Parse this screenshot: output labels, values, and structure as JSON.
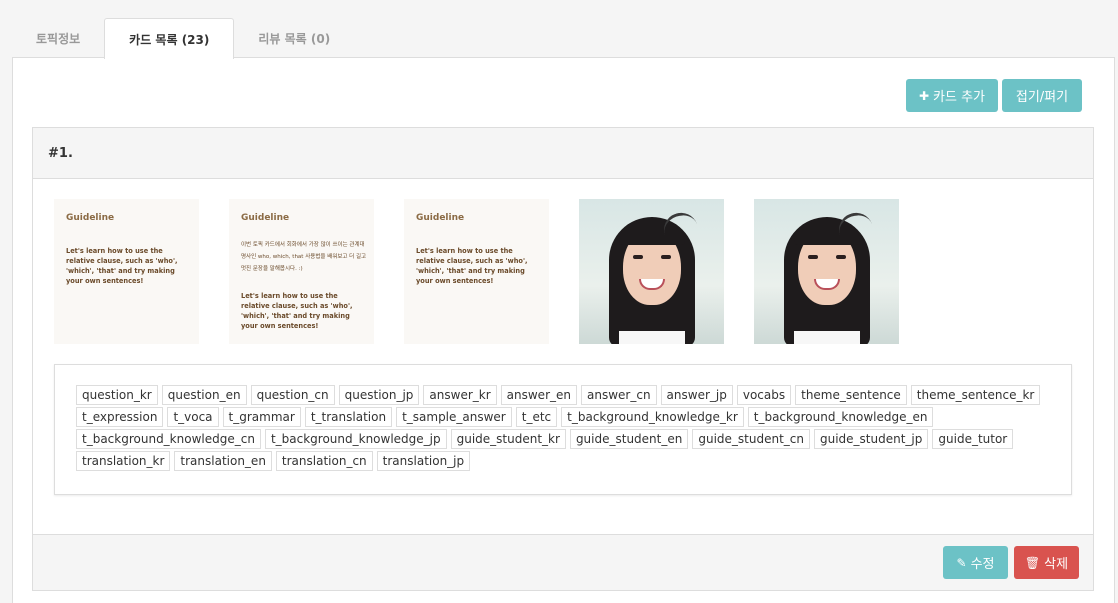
{
  "tabs": [
    {
      "label": "토픽정보",
      "active": false
    },
    {
      "label": "카드 목록 (23)",
      "active": true
    },
    {
      "label": "리뷰 목록 (0)",
      "active": false
    }
  ],
  "toolbar": {
    "add_card_label": "카드 추가",
    "add_card_icon": "plus-icon",
    "collapse_label": "접기/펴기"
  },
  "card": {
    "number": "#1.",
    "images": [
      {
        "type": "guideline",
        "title": "Guideline",
        "kr_text": "",
        "en_text": "Let's learn how to use the relative clause, such as 'who', 'which', 'that' and try making your own sentences!"
      },
      {
        "type": "guideline",
        "title": "Guideline",
        "kr_text": "이번 토픽 카드에서 회화에서 가장 많이 쓰이는 관계대명사인 who, which, that 사용법을 배워보고 더 길고 멋진 문장을 말해봅시다. :)",
        "en_text": "Let's learn how to use the relative clause, such as 'who', 'which', 'that' and try making your own sentences!"
      },
      {
        "type": "guideline",
        "title": "Guideline",
        "kr_text": "",
        "en_text": "Let's learn how to use the relative clause, such as 'who', 'which', 'that' and try making your own sentences!"
      },
      {
        "type": "photo"
      },
      {
        "type": "photo"
      }
    ],
    "tags": [
      "question_kr",
      "question_en",
      "question_cn",
      "question_jp",
      "answer_kr",
      "answer_en",
      "answer_cn",
      "answer_jp",
      "vocabs",
      "theme_sentence",
      "theme_sentence_kr",
      "t_expression",
      "t_voca",
      "t_grammar",
      "t_translation",
      "t_sample_answer",
      "t_etc",
      "t_background_knowledge_kr",
      "t_background_knowledge_en",
      "t_background_knowledge_cn",
      "t_background_knowledge_jp",
      "guide_student_kr",
      "guide_student_en",
      "guide_student_cn",
      "guide_student_jp",
      "guide_tutor",
      "translation_kr",
      "translation_en",
      "translation_cn",
      "translation_jp"
    ],
    "edit_label": "수정",
    "edit_icon": "pencil-icon",
    "delete_label": "삭제",
    "delete_icon": "trash-icon"
  },
  "colors": {
    "teal": "#6cc2c6",
    "red": "#d9534f"
  }
}
